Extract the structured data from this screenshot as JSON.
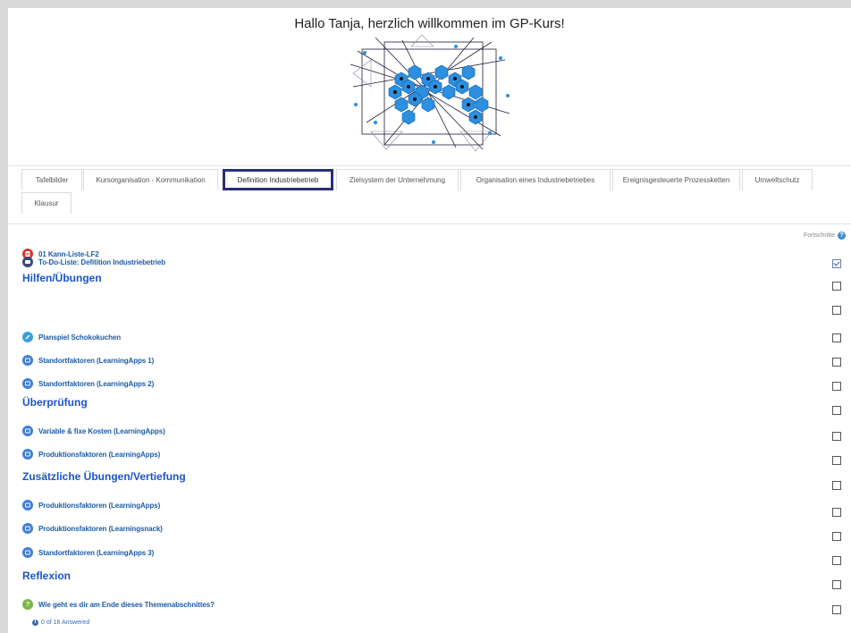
{
  "header": {
    "welcome": "Hallo Tanja, herzlich willkommen im GP-Kurs!"
  },
  "tabs": [
    {
      "label": "Tafelbilder",
      "active": false
    },
    {
      "label": "Kursorganisation - Kommunikation",
      "active": false
    },
    {
      "label": "Definition Industriebetrieb",
      "active": true
    },
    {
      "label": "Zielsystem der Unternehmung",
      "active": false
    },
    {
      "label": "Organisation eines Industriebetriebes",
      "active": false
    },
    {
      "label": "Ereignisgesteuerte Prozessketten",
      "active": false
    },
    {
      "label": "Umweltschutz",
      "active": false
    },
    {
      "label": "Klausur",
      "active": false
    }
  ],
  "progress": {
    "label": "Fortschritte",
    "help_icon": "?"
  },
  "items": {
    "kannliste": "01 Kann-Liste-LF2",
    "todo": "To-Do-Liste: Defitition Industriebetrieb",
    "hilfen_heading": "Hilfen/Übungen",
    "planspiel": "Planspiel Schokokuchen",
    "standort1": "Standortfaktoren (LearningApps 1)",
    "standort2": "Standortfaktoren (LearningApps 2)",
    "pruefung_heading": "Überprüfung",
    "variable": "Variable & fixe Kosten (LearningApps)",
    "produktion1": "Produktionsfaktoren (LearningApps)",
    "zusatz_heading": "Zusätzliche Übungen/Vertiefung",
    "produktion2": "Produktionsfaktoren (LearningApps)",
    "produktion3": "Produktionsfaktoren (Learningsnack)",
    "standort3": "Standortfaktoren (LearningApps 3)",
    "reflexion_heading": "Reflexion",
    "feedback": "Wie geht es dir am Ende dieses Themenabschnittes?",
    "answered": "0 of 16 Answered"
  },
  "completion": {
    "kannliste": true,
    "todo": false
  },
  "colors": {
    "accent_link": "#1c5ca8",
    "section_heading": "#1a55c7",
    "active_tab_border": "#2b2f77",
    "pdf_icon": "#d9342b",
    "forum_icon": "#3a4a7a",
    "app_icon": "#3e7fd6",
    "feedback_icon": "#7ab648"
  },
  "icons": {
    "pdf": "pdf-icon",
    "forum": "chat-icon",
    "app": "learningapp-icon",
    "planspiel": "pencil-icon",
    "feedback": "question-icon"
  }
}
